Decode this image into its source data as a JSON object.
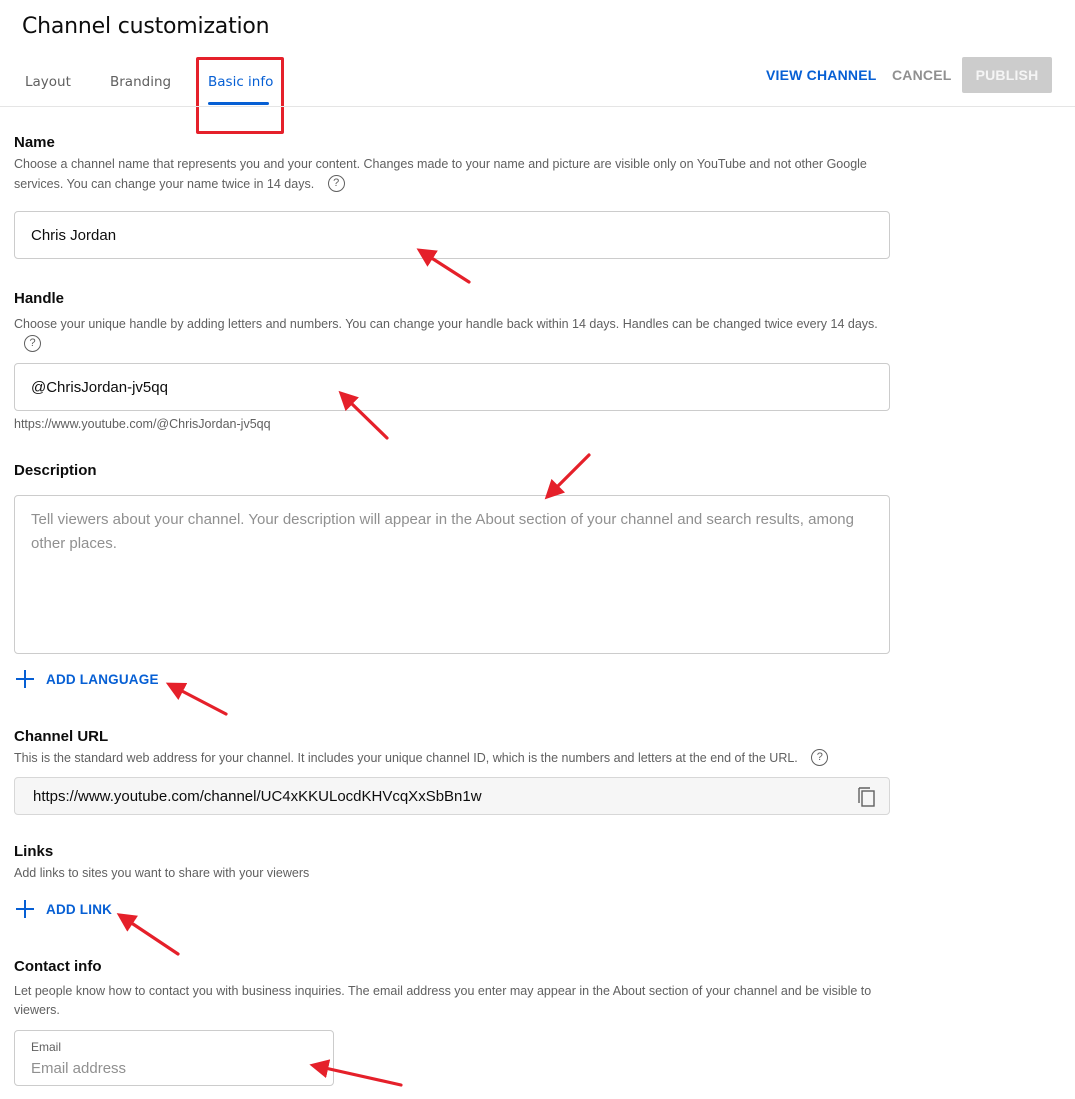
{
  "header": {
    "title": "Channel customization",
    "tabs": [
      {
        "label": "Layout",
        "active": false
      },
      {
        "label": "Branding",
        "active": false
      },
      {
        "label": "Basic info",
        "active": true
      }
    ],
    "actions": {
      "view_channel": "VIEW CHANNEL",
      "cancel": "CANCEL",
      "publish": "PUBLISH"
    }
  },
  "colors": {
    "accent": "#065fd4",
    "annotation": "#e5202a",
    "disabled_button": "#cccccc"
  },
  "sections": {
    "name": {
      "title": "Name",
      "description": "Choose a channel name that represents you and your content. Changes made to your name and picture are visible only on YouTube and not other Google services. You can change your name twice in 14 days.",
      "value": "Chris Jordan"
    },
    "handle": {
      "title": "Handle",
      "description": "Choose your unique handle by adding letters and numbers. You can change your handle back within 14 days. Handles can be changed twice every 14 days.",
      "value": "@ChrisJordan-jv5qq",
      "url": "https://www.youtube.com/@ChrisJordan-jv5qq"
    },
    "description": {
      "title": "Description",
      "placeholder": "Tell viewers about your channel. Your description will appear in the About section of your channel and search results, among other places.",
      "add_language": "ADD LANGUAGE"
    },
    "channel_url": {
      "title": "Channel URL",
      "description": "This is the standard web address for your channel. It includes your unique channel ID, which is the numbers and letters at the end of the URL.",
      "value": "https://www.youtube.com/channel/UC4xKKULocdKHVcqXxSbBn1w"
    },
    "links": {
      "title": "Links",
      "description": "Add links to sites you want to share with your viewers",
      "add_link": "ADD LINK"
    },
    "contact": {
      "title": "Contact info",
      "description": "Let people know how to contact you with business inquiries. The email address you enter may appear in the About section of your channel and be visible to viewers.",
      "email_label": "Email",
      "email_placeholder": "Email address"
    }
  },
  "help_glyph": "?"
}
